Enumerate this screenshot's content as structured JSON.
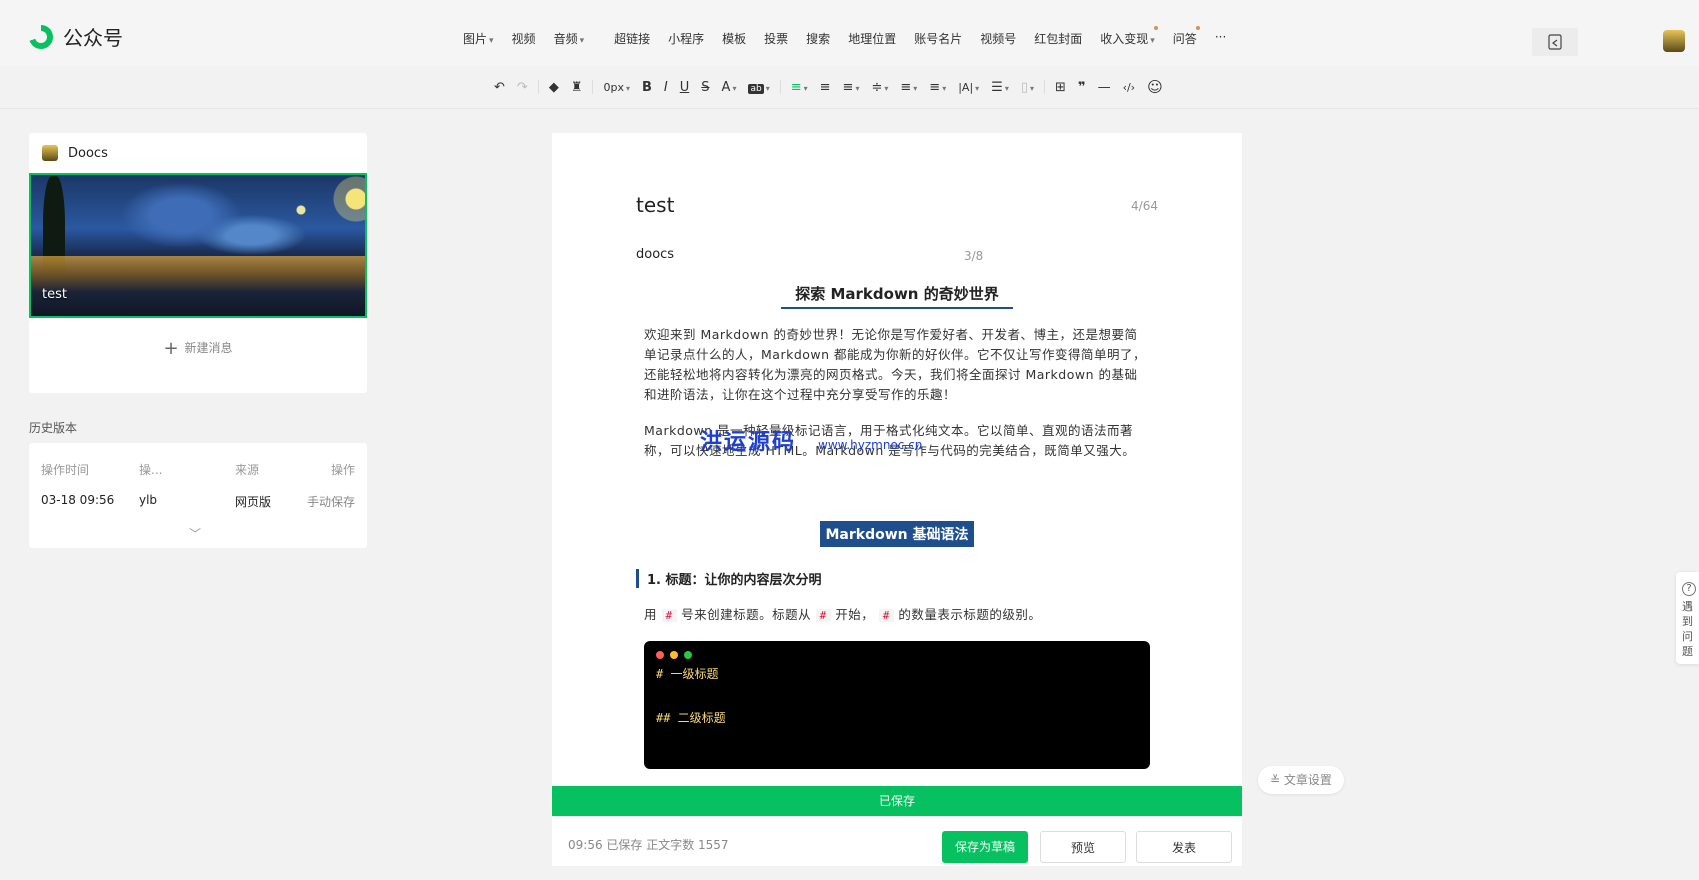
{
  "app": {
    "title": "公众号"
  },
  "menubar": [
    {
      "label": "图片",
      "caret": "▾",
      "dot": false
    },
    {
      "label": "视频",
      "caret": "",
      "dot": false
    },
    {
      "label": "音频",
      "caret": "▾",
      "dot": false
    },
    {
      "label": "超链接",
      "caret": "",
      "dot": false
    },
    {
      "label": "小程序",
      "caret": "",
      "dot": false
    },
    {
      "label": "模板",
      "caret": "",
      "dot": false
    },
    {
      "label": "投票",
      "caret": "",
      "dot": false
    },
    {
      "label": "搜索",
      "caret": "",
      "dot": false
    },
    {
      "label": "地理位置",
      "caret": "",
      "dot": false
    },
    {
      "label": "账号名片",
      "caret": "",
      "dot": false
    },
    {
      "label": "视频号",
      "caret": "",
      "dot": false
    },
    {
      "label": "红包封面",
      "caret": "",
      "dot": false
    },
    {
      "label": "收入变现",
      "caret": "▾",
      "dot": true
    },
    {
      "label": "问答",
      "caret": "",
      "dot": true
    },
    {
      "label": "···",
      "caret": "",
      "dot": false
    }
  ],
  "format_toolbar": {
    "undo": "↶",
    "redo": "↷",
    "format_painter": "◆",
    "clear_format": "♜",
    "font_size": "0px",
    "bold": "B",
    "italic": "I",
    "underline": "U",
    "strike": "S",
    "font_color": "A",
    "bg_color": "ab",
    "align_left": "≡",
    "align_center": "≡",
    "indent": "≡",
    "line_height": "≑",
    "spacing": "≡",
    "margin": "≡",
    "letter_spacing": "|A|",
    "list": "☰",
    "disabled_item": "▯",
    "table": "⊞",
    "quote": "❞",
    "divider": "—",
    "code": "‹/›",
    "emoji": "☺"
  },
  "account": {
    "name": "Doocs"
  },
  "article": {
    "cover_title": "test",
    "new_message": "新建消息"
  },
  "history": {
    "title": "历史版本",
    "columns": [
      "操作时间",
      "操...",
      "来源",
      "操作"
    ],
    "rows": [
      {
        "time": "03-18 09:56",
        "operator": "ylb",
        "source": "网页版",
        "action": "手动保存"
      }
    ],
    "more": "﹀"
  },
  "editor": {
    "title": "test",
    "title_count": "4/64",
    "author": "doocs",
    "author_count": "3/8",
    "heading1": "探索 Markdown 的奇妙世界",
    "para1": "欢迎来到 Markdown 的奇妙世界！无论你是写作爱好者、开发者、博主，还是想要简单记录点什么的人，Markdown 都能成为你新的好伙伴。它不仅让写作变得简单明了，还能轻松地将内容转化为漂亮的网页格式。今天，我们将全面探讨 Markdown 的基础和进阶语法，让你在这个过程中充分享受写作的乐趣！",
    "para2": "Markdown 是一种轻量级标记语言，用于格式化纯文本。它以简单、直观的语法而著称，可以快速地生成 HTML。Markdown 是写作与代码的完美结合，既简单又强大。",
    "heading2": "Markdown 基础语法",
    "heading3": "1. 标题：让你的内容层次分明",
    "para3_a": "用",
    "para3_b": "号来创建标题。标题从",
    "para3_c": "开始，",
    "para3_d": "的数量表示标题的级别。",
    "hash": "#",
    "code_lines": [
      "# 一级标题",
      "## 二级标题"
    ],
    "watermark": "洪运源码",
    "watermark_url": "www.hyzmnoc.cn"
  },
  "status": {
    "saved_bar": "已保存",
    "footer_status": "09:56 已保存  正文字数 1557",
    "save_draft": "保存为草稿",
    "preview": "预览",
    "publish": "发表",
    "article_settings": "文章设置",
    "help": "遇到问题"
  },
  "colors": {
    "brand": "#07c160",
    "heading": "#1f4e8c"
  }
}
